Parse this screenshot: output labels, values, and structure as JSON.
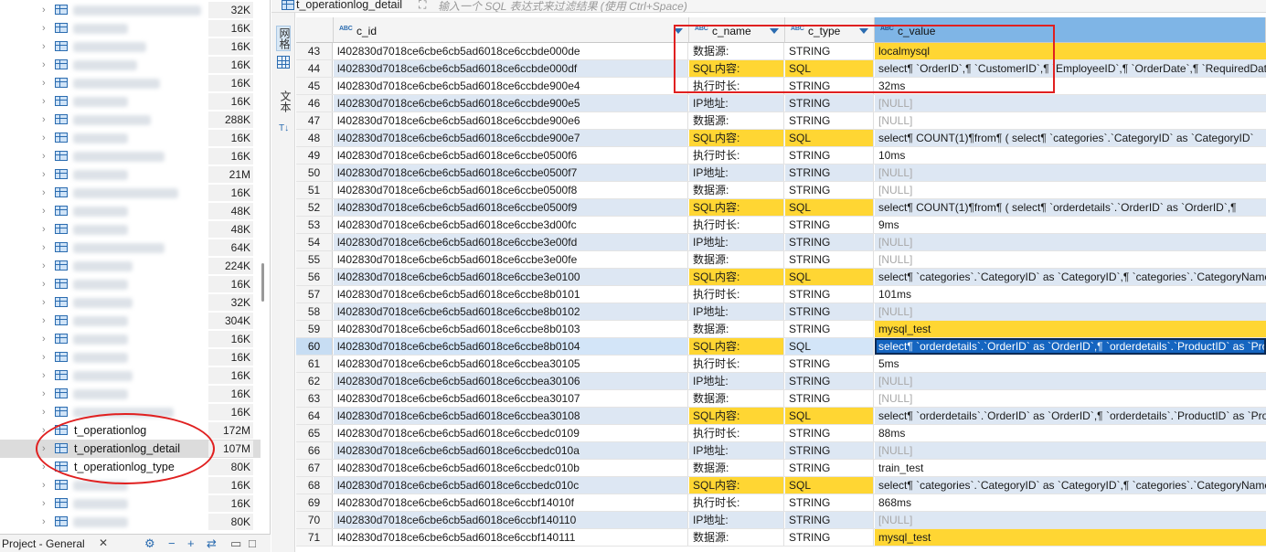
{
  "navigator": {
    "items": [
      {
        "size": "32K",
        "name": "",
        "blur_w": 140
      },
      {
        "size": "16K",
        "name": "",
        "blur_w": 60
      },
      {
        "size": "16K",
        "name": "",
        "blur_w": 80
      },
      {
        "size": "16K",
        "name": "",
        "blur_w": 70
      },
      {
        "size": "16K",
        "name": "",
        "blur_w": 95
      },
      {
        "size": "16K",
        "name": "",
        "blur_w": 60
      },
      {
        "size": "288K",
        "name": "",
        "blur_w": 85
      },
      {
        "size": "16K",
        "name": "",
        "blur_w": 60
      },
      {
        "size": "16K",
        "name": "",
        "blur_w": 100
      },
      {
        "size": "21M",
        "name": "",
        "blur_w": 60
      },
      {
        "size": "16K",
        "name": "",
        "blur_w": 115
      },
      {
        "size": "48K",
        "name": "",
        "blur_w": 60
      },
      {
        "size": "48K",
        "name": "",
        "blur_w": 60
      },
      {
        "size": "64K",
        "name": "",
        "blur_w": 100
      },
      {
        "size": "224K",
        "name": "",
        "blur_w": 65
      },
      {
        "size": "16K",
        "name": "",
        "blur_w": 60
      },
      {
        "size": "32K",
        "name": "",
        "blur_w": 65
      },
      {
        "size": "304K",
        "name": "",
        "blur_w": 60
      },
      {
        "size": "16K",
        "name": "",
        "blur_w": 60
      },
      {
        "size": "16K",
        "name": "",
        "blur_w": 60
      },
      {
        "size": "16K",
        "name": "",
        "blur_w": 65
      },
      {
        "size": "16K",
        "name": "",
        "blur_w": 60
      },
      {
        "size": "16K",
        "name": "",
        "blur_w": 110
      },
      {
        "size": "172M",
        "name": "t_operationlog",
        "blur_w": 0
      },
      {
        "size": "107M",
        "name": "t_operationlog_detail",
        "blur_w": 0,
        "selected": true
      },
      {
        "size": "80K",
        "name": "t_operationlog_type",
        "blur_w": 0
      },
      {
        "size": "16K",
        "name": "",
        "blur_w": 60
      },
      {
        "size": "16K",
        "name": "",
        "blur_w": 60
      },
      {
        "size": "80K",
        "name": "",
        "blur_w": 60
      }
    ]
  },
  "bottom_bar": {
    "project_tab": "Project - General",
    "close": "✕"
  },
  "editor": {
    "tab_title": "t_operationlog_detail",
    "filter_placeholder": "输入一个 SQL 表达式来过滤结果 (使用 Ctrl+Space)",
    "side_tabs": {
      "grid": "网格",
      "text": "文本"
    }
  },
  "grid": {
    "columns": [
      {
        "type": "ABC",
        "name": "c_id"
      },
      {
        "type": "ABC",
        "name": "c_name"
      },
      {
        "type": "ABC",
        "name": "c_type"
      },
      {
        "type": "ABC",
        "name": "c_value"
      }
    ],
    "rows": [
      {
        "n": "43",
        "id": "l402830d7018ce6cbe6cb5ad6018ce6ccbde000de",
        "name": "数据源:",
        "type": "STRING",
        "value": "localmysql",
        "hl": "value"
      },
      {
        "n": "44",
        "id": "l402830d7018ce6cbe6cb5ad6018ce6ccbde000df",
        "name": "SQL内容:",
        "type": "SQL",
        "value": "select¶   `OrderID`,¶   `CustomerID`,¶   `EmployeeID`,¶   `OrderDate`,¶   `RequiredDate`",
        "hl": "nametype"
      },
      {
        "n": "45",
        "id": "l402830d7018ce6cbe6cb5ad6018ce6ccbde900e4",
        "name": "执行时长:",
        "type": "STRING",
        "value": "32ms",
        "hl": ""
      },
      {
        "n": "46",
        "id": "l402830d7018ce6cbe6cb5ad6018ce6ccbde900e5",
        "name": "IP地址:",
        "type": "STRING",
        "value": "[NULL]",
        "hl": ""
      },
      {
        "n": "47",
        "id": "l402830d7018ce6cbe6cb5ad6018ce6ccbde900e6",
        "name": "数据源:",
        "type": "STRING",
        "value": "[NULL]",
        "hl": ""
      },
      {
        "n": "48",
        "id": "l402830d7018ce6cbe6cb5ad6018ce6ccbde900e7",
        "name": "SQL内容:",
        "type": "SQL",
        "value": "select¶   COUNT(1)¶from¶   ( select¶       `categories`.`CategoryID` as `CategoryID`",
        "hl": "nametype"
      },
      {
        "n": "49",
        "id": "l402830d7018ce6cbe6cb5ad6018ce6ccbe0500f6",
        "name": "执行时长:",
        "type": "STRING",
        "value": "10ms",
        "hl": ""
      },
      {
        "n": "50",
        "id": "l402830d7018ce6cbe6cb5ad6018ce6ccbe0500f7",
        "name": "IP地址:",
        "type": "STRING",
        "value": "[NULL]",
        "hl": ""
      },
      {
        "n": "51",
        "id": "l402830d7018ce6cbe6cb5ad6018ce6ccbe0500f8",
        "name": "数据源:",
        "type": "STRING",
        "value": "[NULL]",
        "hl": ""
      },
      {
        "n": "52",
        "id": "l402830d7018ce6cbe6cb5ad6018ce6ccbe0500f9",
        "name": "SQL内容:",
        "type": "SQL",
        "value": "select¶   COUNT(1)¶from¶   ( select¶       `orderdetails`.`OrderID` as `OrderID`,¶",
        "hl": "nametype"
      },
      {
        "n": "53",
        "id": "l402830d7018ce6cbe6cb5ad6018ce6ccbe3d00fc",
        "name": "执行时长:",
        "type": "STRING",
        "value": "9ms",
        "hl": ""
      },
      {
        "n": "54",
        "id": "l402830d7018ce6cbe6cb5ad6018ce6ccbe3e00fd",
        "name": "IP地址:",
        "type": "STRING",
        "value": "[NULL]",
        "hl": ""
      },
      {
        "n": "55",
        "id": "l402830d7018ce6cbe6cb5ad6018ce6ccbe3e00fe",
        "name": "数据源:",
        "type": "STRING",
        "value": "[NULL]",
        "hl": ""
      },
      {
        "n": "56",
        "id": "l402830d7018ce6cbe6cb5ad6018ce6ccbe3e0100",
        "name": "SQL内容:",
        "type": "SQL",
        "value": "select¶   `categories`.`CategoryID` as `CategoryID`,¶   `categories`.`CategoryName`",
        "hl": "nametype"
      },
      {
        "n": "57",
        "id": "l402830d7018ce6cbe6cb5ad6018ce6ccbe8b0101",
        "name": "执行时长:",
        "type": "STRING",
        "value": "101ms",
        "hl": ""
      },
      {
        "n": "58",
        "id": "l402830d7018ce6cbe6cb5ad6018ce6ccbe8b0102",
        "name": "IP地址:",
        "type": "STRING",
        "value": "[NULL]",
        "hl": ""
      },
      {
        "n": "59",
        "id": "l402830d7018ce6cbe6cb5ad6018ce6ccbe8b0103",
        "name": "数据源:",
        "type": "STRING",
        "value": "mysql_test",
        "hl": "value"
      },
      {
        "n": "60",
        "id": "l402830d7018ce6cbe6cb5ad6018ce6ccbe8b0104",
        "name": "SQL内容:",
        "type": "SQL",
        "value": "select¶   `orderdetails`.`OrderID` as `OrderID`,¶   `orderdetails`.`ProductID` as `ProductID`",
        "hl": "name",
        "selected": true
      },
      {
        "n": "61",
        "id": "l402830d7018ce6cbe6cb5ad6018ce6ccbea30105",
        "name": "执行时长:",
        "type": "STRING",
        "value": "5ms",
        "hl": ""
      },
      {
        "n": "62",
        "id": "l402830d7018ce6cbe6cb5ad6018ce6ccbea30106",
        "name": "IP地址:",
        "type": "STRING",
        "value": "[NULL]",
        "hl": ""
      },
      {
        "n": "63",
        "id": "l402830d7018ce6cbe6cb5ad6018ce6ccbea30107",
        "name": "数据源:",
        "type": "STRING",
        "value": "[NULL]",
        "hl": ""
      },
      {
        "n": "64",
        "id": "l402830d7018ce6cbe6cb5ad6018ce6ccbea30108",
        "name": "SQL内容:",
        "type": "SQL",
        "value": "select¶   `orderdetails`.`OrderID` as `OrderID`,¶   `orderdetails`.`ProductID` as `ProductID`",
        "hl": "nametype"
      },
      {
        "n": "65",
        "id": "l402830d7018ce6cbe6cb5ad6018ce6ccbedc0109",
        "name": "执行时长:",
        "type": "STRING",
        "value": "88ms",
        "hl": ""
      },
      {
        "n": "66",
        "id": "l402830d7018ce6cbe6cb5ad6018ce6ccbedc010a",
        "name": "IP地址:",
        "type": "STRING",
        "value": "[NULL]",
        "hl": ""
      },
      {
        "n": "67",
        "id": "l402830d7018ce6cbe6cb5ad6018ce6ccbedc010b",
        "name": "数据源:",
        "type": "STRING",
        "value": "train_test",
        "hl": ""
      },
      {
        "n": "68",
        "id": "l402830d7018ce6cbe6cb5ad6018ce6ccbedc010c",
        "name": "SQL内容:",
        "type": "SQL",
        "value": "select¶   `categories`.`CategoryID` as `CategoryID`,¶   `categories`.`CategoryName`",
        "hl": "nametype"
      },
      {
        "n": "69",
        "id": "l402830d7018ce6cbe6cb5ad6018ce6ccbf14010f",
        "name": "执行时长:",
        "type": "STRING",
        "value": "868ms",
        "hl": ""
      },
      {
        "n": "70",
        "id": "l402830d7018ce6cbe6cb5ad6018ce6ccbf140110",
        "name": "IP地址:",
        "type": "STRING",
        "value": "[NULL]",
        "hl": ""
      },
      {
        "n": "71",
        "id": "l402830d7018ce6cbe6cb5ad6018ce6ccbf140111",
        "name": "数据源:",
        "type": "STRING",
        "value": "mysql_test",
        "hl": "value"
      }
    ]
  }
}
